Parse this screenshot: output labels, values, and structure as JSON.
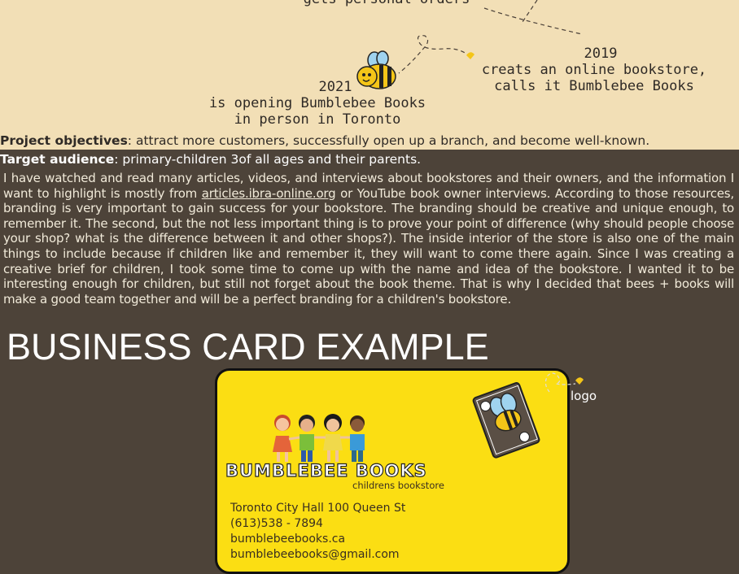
{
  "timeline": {
    "header_text": "gets personal orders",
    "item_2019": {
      "year": "2019",
      "line1": "creats an online bookstore,",
      "line2": "calls it Bumblebee Books"
    },
    "item_2021": {
      "year": "2021",
      "line1": "is opening Bumblebee Books",
      "line2": "in person in Toronto"
    }
  },
  "objectives": {
    "label": "Project objectives",
    "text": ": attract more customers, successfully open up a branch, and become well-known."
  },
  "audience": {
    "label": "Target audience",
    "text": ": primary-children 3of all ages and their parents."
  },
  "body": {
    "part1": "I have watched and read many articles, videos, and interviews about bookstores and their owners, and the information I want to highlight is mostly from ",
    "link": "articles.ibra-online.org",
    "part2": " or YouTube book owner interviews. According to those resources, branding is very important to gain success for your bookstore. The branding should be creative and unique enough, to remember it. The second, but the not less important thing is to prove your point of difference (why should people choose your shop? what is the difference between it and other shops?). The inside interior of the store is also one of the main things to include because if children like and remember it, they will want to come there again. Since I was creating a creative brief for children, I took some time to come up with the name and idea of the bookstore. I wanted it to be interesting enough for children, but still not forget about the book theme. That is why I decided that bees + books will make a good team together and will be a perfect branding for a children's bookstore."
  },
  "section_heading": "BUSINESS CARD EXAMPLE",
  "card": {
    "brand_name": "BUMBLEBEE BOOKS",
    "brand_sub": "childrens bookstore",
    "address": "Toronto City Hall 100 Queen St",
    "phone": "(613)538 - 7894",
    "website": "bumblebeebooks.ca",
    "email": "bumblebeebooks@gmail.com",
    "background_color": "#fbde13"
  },
  "logo_label": "logo",
  "colors": {
    "top_background": "#f2dfb6",
    "page_background": "#4d4339",
    "accent_yellow": "#fbde13"
  }
}
